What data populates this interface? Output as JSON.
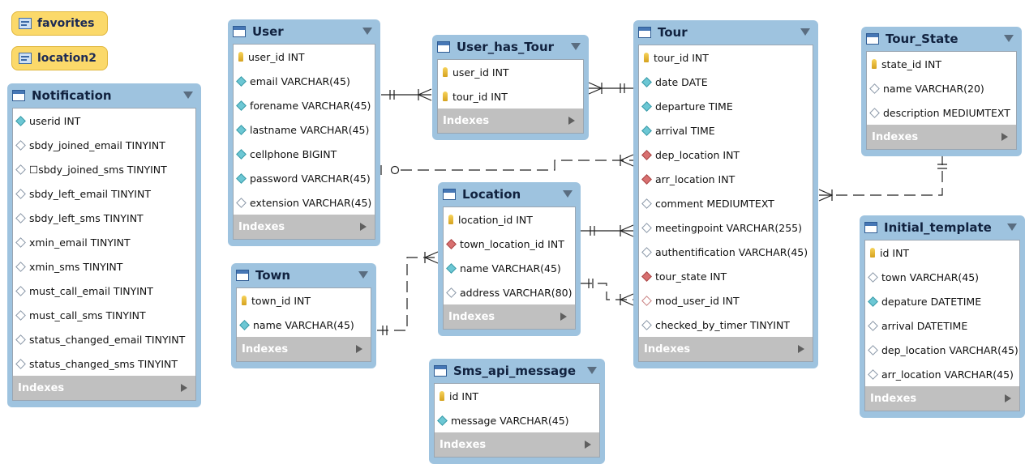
{
  "views": [
    {
      "name": "favorites"
    },
    {
      "name": "location2"
    }
  ],
  "tables": [
    {
      "id": "notification",
      "name": "Notification",
      "columns": [
        {
          "label": "userid INT",
          "kind": "nn"
        },
        {
          "label": "sbdy_joined_email TINYINT",
          "kind": "nul"
        },
        {
          "label": "☐sbdy_joined_sms TINYINT",
          "kind": "nul"
        },
        {
          "label": "sbdy_left_email TINYINT",
          "kind": "nul"
        },
        {
          "label": "sbdy_left_sms TINYINT",
          "kind": "nul"
        },
        {
          "label": "xmin_email TINYINT",
          "kind": "nul"
        },
        {
          "label": "xmin_sms TINYINT",
          "kind": "nul"
        },
        {
          "label": "must_call_email TINYINT",
          "kind": "nul"
        },
        {
          "label": "must_call_sms TINYINT",
          "kind": "nul"
        },
        {
          "label": "status_changed_email TINYINT",
          "kind": "nul"
        },
        {
          "label": "status_changed_sms TINYINT",
          "kind": "nul"
        }
      ],
      "indexes_label": "Indexes"
    },
    {
      "id": "user",
      "name": "User",
      "columns": [
        {
          "label": "user_id INT",
          "kind": "pk"
        },
        {
          "label": "email VARCHAR(45)",
          "kind": "nn"
        },
        {
          "label": "forename VARCHAR(45)",
          "kind": "nn"
        },
        {
          "label": "lastname VARCHAR(45)",
          "kind": "nn"
        },
        {
          "label": "cellphone BIGINT",
          "kind": "nn"
        },
        {
          "label": "password VARCHAR(45)",
          "kind": "nn"
        },
        {
          "label": "extension VARCHAR(45)",
          "kind": "nul"
        }
      ],
      "indexes_label": "Indexes"
    },
    {
      "id": "user_has_tour",
      "name": "User_has_Tour",
      "columns": [
        {
          "label": "user_id INT",
          "kind": "pk"
        },
        {
          "label": "tour_id INT",
          "kind": "pk"
        }
      ],
      "indexes_label": "Indexes"
    },
    {
      "id": "tour",
      "name": "Tour",
      "columns": [
        {
          "label": "tour_id INT",
          "kind": "pk"
        },
        {
          "label": "date DATE",
          "kind": "nn"
        },
        {
          "label": "departure TIME",
          "kind": "nn"
        },
        {
          "label": "arrival TIME",
          "kind": "nn"
        },
        {
          "label": "dep_location INT",
          "kind": "fk"
        },
        {
          "label": "arr_location INT",
          "kind": "fk"
        },
        {
          "label": "comment MEDIUMTEXT",
          "kind": "nul"
        },
        {
          "label": "meetingpoint VARCHAR(255)",
          "kind": "nul"
        },
        {
          "label": "authentification VARCHAR(45)",
          "kind": "nul"
        },
        {
          "label": "tour_state INT",
          "kind": "fk"
        },
        {
          "label": "mod_user_id INT",
          "kind": "fkn"
        },
        {
          "label": "checked_by_timer TINYINT",
          "kind": "nul"
        }
      ],
      "indexes_label": "Indexes"
    },
    {
      "id": "tour_state",
      "name": "Tour_State",
      "columns": [
        {
          "label": "state_id INT",
          "kind": "pk"
        },
        {
          "label": "name VARCHAR(20)",
          "kind": "nul"
        },
        {
          "label": "description MEDIUMTEXT",
          "kind": "nul"
        }
      ],
      "indexes_label": "Indexes"
    },
    {
      "id": "location",
      "name": "Location",
      "columns": [
        {
          "label": "location_id INT",
          "kind": "pk"
        },
        {
          "label": "town_location_id INT",
          "kind": "fk"
        },
        {
          "label": "name VARCHAR(45)",
          "kind": "nn"
        },
        {
          "label": "address VARCHAR(80)",
          "kind": "nul"
        }
      ],
      "indexes_label": "Indexes"
    },
    {
      "id": "town",
      "name": "Town",
      "columns": [
        {
          "label": "town_id INT",
          "kind": "pk"
        },
        {
          "label": "name VARCHAR(45)",
          "kind": "nn"
        }
      ],
      "indexes_label": "Indexes"
    },
    {
      "id": "sms_api_message",
      "name": "Sms_api_message",
      "columns": [
        {
          "label": "id INT",
          "kind": "pk"
        },
        {
          "label": "message VARCHAR(45)",
          "kind": "nn"
        }
      ],
      "indexes_label": "Indexes"
    },
    {
      "id": "initial_template",
      "name": "Initial_template",
      "columns": [
        {
          "label": "id INT",
          "kind": "pk"
        },
        {
          "label": "town VARCHAR(45)",
          "kind": "nul"
        },
        {
          "label": "depature DATETIME",
          "kind": "nn"
        },
        {
          "label": "arrival DATETIME",
          "kind": "nul"
        },
        {
          "label": "dep_location VARCHAR(45)",
          "kind": "nul"
        },
        {
          "label": "arr_location VARCHAR(45)",
          "kind": "nul"
        }
      ],
      "indexes_label": "Indexes"
    }
  ]
}
